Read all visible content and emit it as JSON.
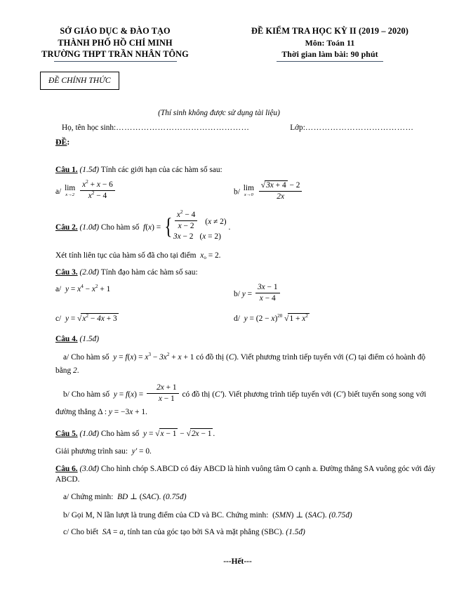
{
  "header": {
    "left": {
      "line1": "SỞ GIÁO DỤC & ĐÀO TẠO",
      "line2": "THÀNH PHỐ HỒ CHÍ MINH",
      "line3": "TRƯỜNG THPT TRẦN NHÂN TÔNG"
    },
    "right": {
      "title": "ĐỀ KIỂM TRA HỌC KỲ II (2019 – 2020)",
      "subject": "Môn: Toán 11",
      "duration": "Thời gian làm bài: 90 phút"
    }
  },
  "stamp": {
    "label": "ĐỀ CHÍNH THỨC"
  },
  "notice": "(Thí sinh không được sử dụng tài liệu)",
  "name_line": {
    "student_label": "Họ, tên học sinh:",
    "student_dots": "…………………………………………",
    "class_label": "Lớp:",
    "class_dots": "…………………………………"
  },
  "de_label": "ĐỀ",
  "de_colon": ":",
  "questions": [
    {
      "num": "Câu 1.",
      "points": "(1.5đ)",
      "prompt": "Tính các giới hạn của các hàm số sau:",
      "a_label": "a/",
      "a_limit_var": "x→2",
      "a_num": "x² + x – 6",
      "a_den": "x² – 4",
      "b_label": "b/",
      "b_limit_var": "x→0",
      "b_num": "√(3x + 4) – 2",
      "b_den": "2x"
    },
    {
      "num": "Câu 2.",
      "points": "(1.0đ)",
      "prompt": "Cho hàm số",
      "fn": "f(x) =",
      "case1_num": "x² – 4",
      "case1_den": "x – 2",
      "case1_cond": "(x ≠ 2)",
      "case2_expr": "3x – 2",
      "case2_cond": "(x = 2)",
      "tail": ".",
      "followup": "Xét tính liên tục của hàm số đã cho tại điểm",
      "followup_math": "x₀ = 2",
      "followup_end": "."
    },
    {
      "num": "Câu 3.",
      "points": "(2.0đ)",
      "prompt": "Tính đạo hàm các hàm số sau:",
      "a_label": "a/",
      "a_expr": "y = x⁴ – x² + 1",
      "b_label": "b/",
      "b_num": "3x – 1",
      "b_den": "x – 4",
      "c_label": "c/",
      "c_expr": "y = √(x² – 4x + 3)",
      "d_label": "d/",
      "d_expr": "y = (2 – x)²⁰ √(1 + x²)"
    },
    {
      "num": "Câu 4.",
      "points": "(1.5đ)",
      "a_text_1": "a/ Cho hàm số",
      "a_math": "y = f(x) = x³ – 3x² + x + 1",
      "a_text_2": "có đồ thị",
      "a_curve": "(C)",
      "a_text_3": ". Viết  phương trình tiếp tuyến với",
      "a_curve_2": "(C)",
      "a_text_4": "tại điểm có hoành độ bằng",
      "a_value": "2",
      "a_end": ".",
      "b_text_1": "b/ Cho hàm số",
      "b_fn": "y = f(x) =",
      "b_num": "2x + 1",
      "b_den": "x – 1",
      "b_text_2": "có đồ thị",
      "b_curve": "(C')",
      "b_text_3": ". Viết  phương trình tiếp tuyến với",
      "b_curve_2": "(C')",
      "b_text_4": "biết tuyến song song với đường thẳng",
      "b_line": "Δ : y = –3x + 1",
      "b_end": "."
    },
    {
      "num": "Câu 5.",
      "points": "(1.0đ)",
      "prompt": "Cho hàm số",
      "expr": "y = √(x – 1) – √(2x – 1)",
      "expr_end": ".",
      "followup": "Giải phương trình sau:",
      "followup_math": "y' = 0",
      "followup_end": "."
    },
    {
      "num": "Câu 6.",
      "points": "(3.0đ)",
      "prompt_1": "Cho hình chóp S.ABCD có đáy ABCD là hình vuông tâm O cạnh a. Đường thẳng SA vuông góc với đáy ABCD.",
      "a_text": "a/ Chứng minh:",
      "a_math": "BD ⊥ (SAC)",
      "a_dot": ".",
      "a_points": "(0.75đ)",
      "b_text": "b/ Gọi M, N lần lượt là trung điểm của CD và BC. Chứng minh:",
      "b_math": "(SMN) ⊥ (SAC)",
      "b_dot": ".",
      "b_points": "(0.75đ)",
      "c_text_1": "c/ Cho biết",
      "c_math": "SA = a",
      "c_text_2": ", tính tan của góc tạo bởi SA và mặt phẳng (SBC).",
      "c_points": "(1.5đ)"
    }
  ],
  "ending": "---Hết---"
}
